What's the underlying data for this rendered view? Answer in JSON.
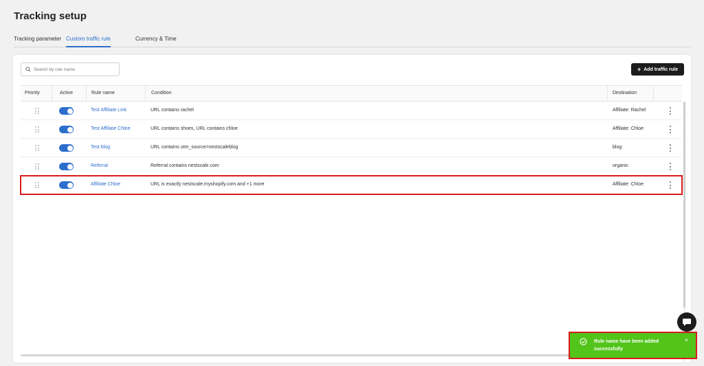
{
  "page": {
    "title": "Tracking setup"
  },
  "tabs": [
    {
      "label": "Tracking parameter",
      "active": false
    },
    {
      "label": "Custom traffic rule",
      "active": true
    },
    {
      "label": "Currency & Time",
      "active": false
    }
  ],
  "search": {
    "placeholder": "Search by rule name",
    "value": ""
  },
  "add_button": {
    "label": "Add traffic rule",
    "icon": "plus-icon"
  },
  "table": {
    "headers": [
      "Priority",
      "Active",
      "Rule name",
      "Condition",
      "Destination"
    ],
    "rows": [
      {
        "active": true,
        "name": "Test Affiliate Link",
        "condition": "URL contains rachel",
        "destination": "Affiliate: Rachel"
      },
      {
        "active": true,
        "name": "Test Affiliate Chloe",
        "condition": "URL contains shoes, URL contains chloe",
        "destination": "Affiliate: Chloe"
      },
      {
        "active": true,
        "name": "Test blog",
        "condition": "URL contains utm_source=nestscaleblog",
        "destination": "blog"
      },
      {
        "active": true,
        "name": "Referral",
        "condition": "Referral contains nestscale.com",
        "destination": "organic"
      },
      {
        "active": true,
        "name": "Affiliate Chloe",
        "condition": "URL is exactly nestscale.myshopify.com and +1 more",
        "destination": "Affiliate: Chloe",
        "highlighted": true
      }
    ]
  },
  "toast": {
    "message": "Rule name have been added successfully",
    "icon": "check-circle-icon",
    "close_icon": "close-icon"
  },
  "chat": {
    "icon": "chat-bubble-icon"
  },
  "colors": {
    "accent": "#2c6ecb",
    "success": "#52c41a",
    "highlight": "#d81a1a",
    "dark_button": "#1c1c1c"
  }
}
